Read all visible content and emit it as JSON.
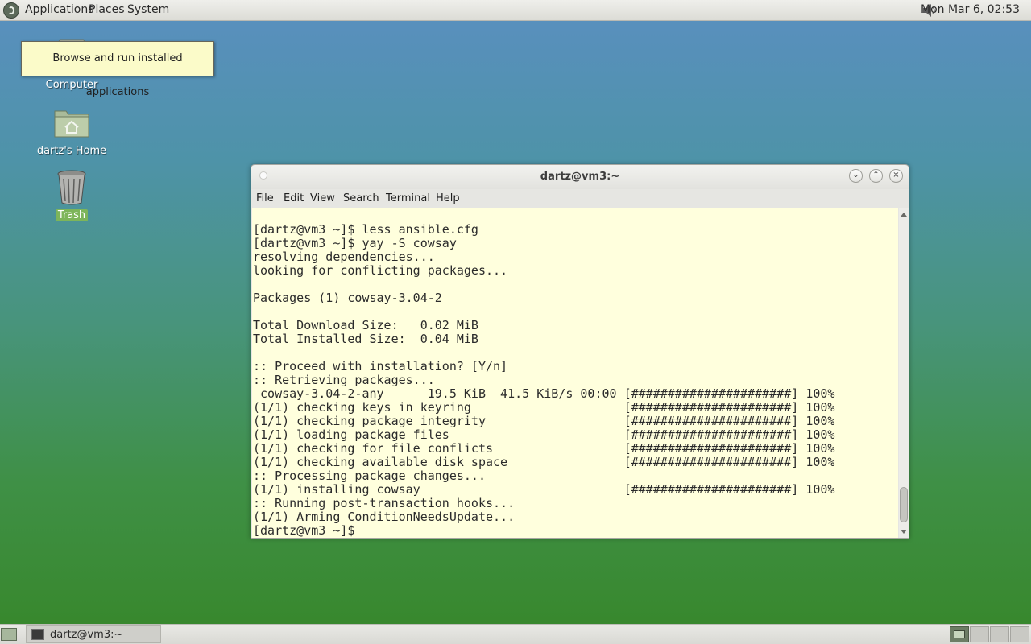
{
  "top_panel": {
    "menus": [
      "Applications",
      "Places",
      "System"
    ],
    "clock": "Mon Mar  6, 02:53"
  },
  "tooltip": {
    "text": "Browse and run installed applications"
  },
  "desktop_icons": {
    "computer": "Computer",
    "home": "dartz's Home",
    "trash": "Trash"
  },
  "terminal": {
    "title": "dartz@vm3:~",
    "menus": [
      "File",
      "Edit",
      "View",
      "Search",
      "Terminal",
      "Help"
    ],
    "lines": [
      "[dartz@vm3 ~]$ less ansible.cfg",
      "[dartz@vm3 ~]$ yay -S cowsay",
      "resolving dependencies...",
      "looking for conflicting packages...",
      "",
      "Packages (1) cowsay-3.04-2",
      "",
      "Total Download Size:   0.02 MiB",
      "Total Installed Size:  0.04 MiB",
      "",
      ":: Proceed with installation? [Y/n]",
      ":: Retrieving packages...",
      " cowsay-3.04-2-any      19.5 KiB  41.5 KiB/s 00:00 [######################] 100%",
      "(1/1) checking keys in keyring                     [######################] 100%",
      "(1/1) checking package integrity                   [######################] 100%",
      "(1/1) loading package files                        [######################] 100%",
      "(1/1) checking for file conflicts                  [######################] 100%",
      "(1/1) checking available disk space                [######################] 100%",
      ":: Processing package changes...",
      "(1/1) installing cowsay                            [######################] 100%",
      ":: Running post-transaction hooks...",
      "(1/1) Arming ConditionNeedsUpdate...",
      "[dartz@vm3 ~]$"
    ]
  },
  "taskbar": {
    "window_button": "dartz@vm3:~"
  },
  "colors": {
    "terminal_bg": "#ffffdd",
    "tooltip_bg": "#fbfbc9",
    "selected_label_bg": "#7db55a"
  },
  "icons": [
    "menu-logo-icon",
    "volume-icon",
    "computer-icon",
    "home-folder-icon",
    "trash-icon",
    "terminal-icon",
    "show-desktop-icon",
    "minimize-icon",
    "maximize-icon",
    "close-icon"
  ]
}
